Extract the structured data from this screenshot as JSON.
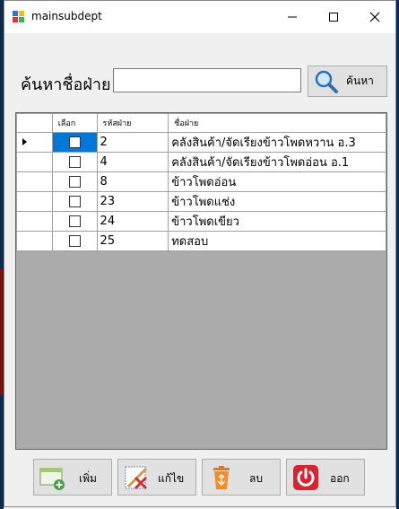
{
  "window": {
    "title": "mainsubdept"
  },
  "search": {
    "label": "ค้นหาชื่อฝ่าย",
    "value": "",
    "placeholder": "",
    "button_label": "ค้นหา"
  },
  "grid": {
    "columns": [
      "เลือก",
      "รหัสฝ่าย",
      "ชื่อฝ่าย"
    ],
    "rows": [
      {
        "checked": false,
        "code": "2",
        "name": "คลังสินค้า/จัดเรียงข้าวโพดหวาน อ.3"
      },
      {
        "checked": false,
        "code": "4",
        "name": "คลังสินค้า/จัดเรียงข้าวโพดอ่อน อ.1"
      },
      {
        "checked": false,
        "code": "8",
        "name": "ข้าวโพดอ่อน"
      },
      {
        "checked": false,
        "code": "23",
        "name": "ข้าวโพดแช่ง"
      },
      {
        "checked": false,
        "code": "24",
        "name": "ข้าวโพดเขียว"
      },
      {
        "checked": false,
        "code": "25",
        "name": "ทดสอบ"
      }
    ]
  },
  "buttons": {
    "add": "เพิ่ม",
    "edit": "แก้ไข",
    "delete": "ลบ",
    "exit": "ออก"
  },
  "colors": {
    "selection": "#0078d7",
    "grid_empty": "#ababab",
    "exit_red": "#d9232e",
    "trash_orange": "#f28c28"
  }
}
